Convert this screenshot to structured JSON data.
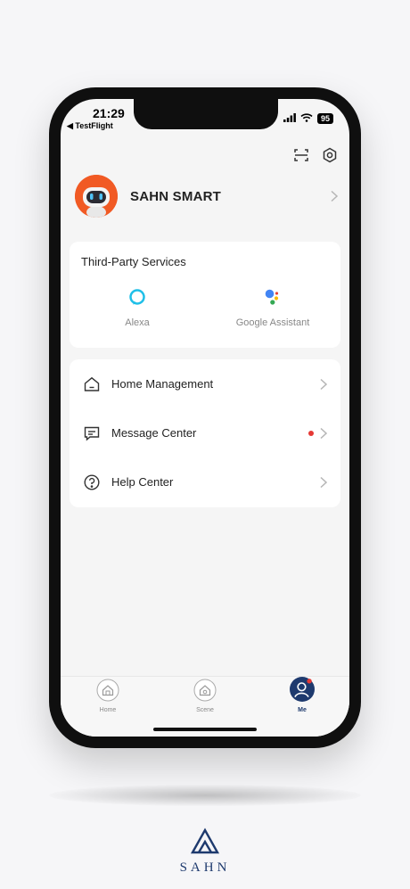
{
  "status": {
    "time": "21:29",
    "back_label": "◀ TestFlight",
    "battery": "95"
  },
  "profile": {
    "name": "SAHN SMART"
  },
  "third_party": {
    "title": "Third-Party Services",
    "services": [
      {
        "label": "Alexa",
        "icon": "alexa-icon",
        "color": "#1fbfe8"
      },
      {
        "label": "Google Assistant",
        "icon": "google-assistant-icon"
      }
    ]
  },
  "menu": [
    {
      "label": "Home Management",
      "icon": "home-icon",
      "badge": false
    },
    {
      "label": "Message Center",
      "icon": "message-icon",
      "badge": true
    },
    {
      "label": "Help Center",
      "icon": "help-icon",
      "badge": false
    }
  ],
  "tabs": [
    {
      "label": "Home",
      "active": false
    },
    {
      "label": "Scene",
      "active": false
    },
    {
      "label": "Me",
      "active": true
    }
  ],
  "brand": {
    "logo_text": "SAHN",
    "color": "#1e3a6e"
  }
}
